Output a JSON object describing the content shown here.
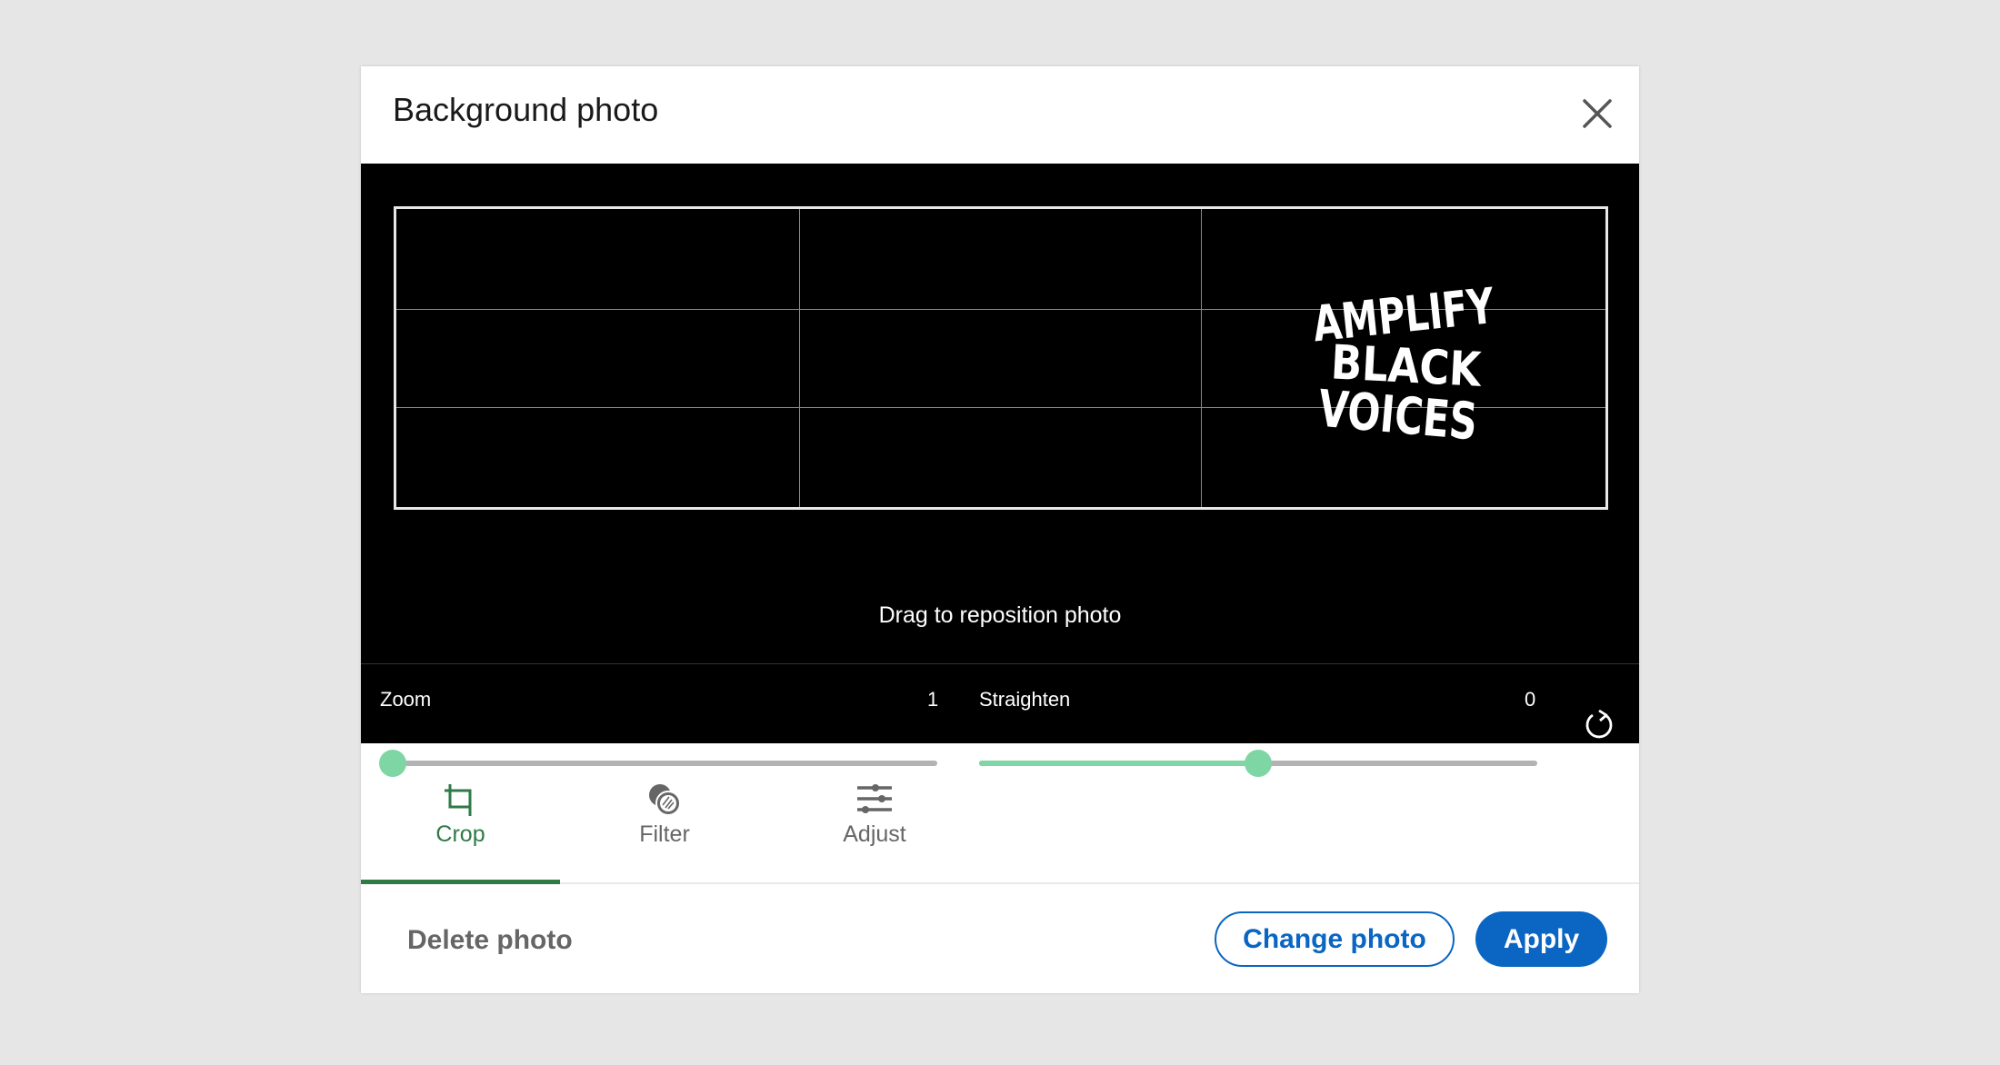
{
  "dialog": {
    "title": "Background photo",
    "close_icon": "close-icon"
  },
  "editor": {
    "hint": "Drag to reposition photo",
    "logo_lines": [
      "AMPLIFY",
      "BLACK",
      "VOICES"
    ],
    "zoom": {
      "label": "Zoom",
      "value": "1",
      "fraction": 0
    },
    "straighten": {
      "label": "Straighten",
      "value": "0",
      "fraction": 0.5
    },
    "reset_icon": "rotate-icon",
    "slider_color": "#7fd6a5"
  },
  "tabs": [
    {
      "label": "Crop",
      "icon": "crop-icon",
      "active": true
    },
    {
      "label": "Filter",
      "icon": "filter-icon",
      "active": false
    },
    {
      "label": "Adjust",
      "icon": "adjust-icon",
      "active": false
    }
  ],
  "footer": {
    "delete_label": "Delete photo",
    "change_label": "Change photo",
    "apply_label": "Apply"
  },
  "colors": {
    "accent": "#0a66c2",
    "active_tab": "#2f7a47"
  }
}
